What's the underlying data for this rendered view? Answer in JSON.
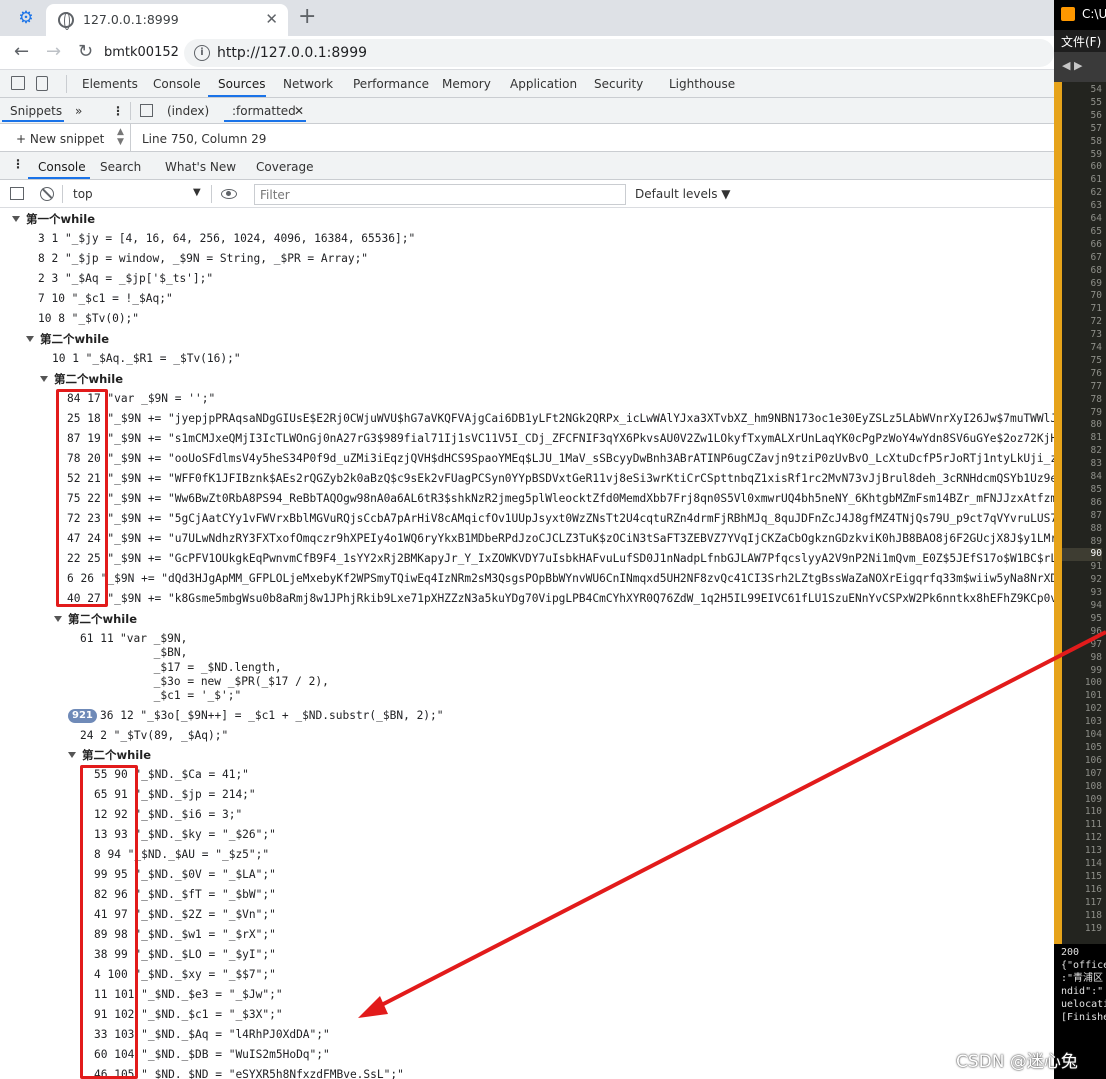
{
  "browser": {
    "tab_title": "127.0.0.1:8999",
    "profile_label": "bmtk00152",
    "url": "http://127.0.0.1:8999"
  },
  "devtools": {
    "tabs": [
      "Elements",
      "Console",
      "Sources",
      "Network",
      "Performance",
      "Memory",
      "Application",
      "Security",
      "Lighthouse"
    ],
    "active_tab": "Sources"
  },
  "sources": {
    "snippets_label": "Snippets",
    "more_label": "»",
    "file_index": "(index)",
    "file_formatted": ":formatted",
    "new_snippet": "+ New snippet",
    "position": "Line 750, Column 29"
  },
  "drawer": {
    "tabs": [
      "Console",
      "Search",
      "What's New",
      "Coverage"
    ],
    "active": "Console"
  },
  "console_toolbar": {
    "context": "top",
    "filter_placeholder": "Filter",
    "levels": "Default levels ▼"
  },
  "console": {
    "group1": "第一个while",
    "group2": "第二个while",
    "g1_rows": [
      "3 1 \"_$jy = [4, 16, 64, 256, 1024, 4096, 16384, 65536];\"",
      "8 2 \"_$jp = window, _$9N = String, _$PR = Array;\"",
      "2 3 \"_$Aq = _$jp['$_ts'];\"",
      "7 10 \"_$c1 = !_$Aq;\"",
      "10 8 \"_$Tv(0);\""
    ],
    "g2_row": "10 1 \"_$Aq._$R1 = _$Tv(16);\"",
    "box1_rows": [
      "84 17 \"var _$9N = '';\"",
      "25 18 \"_$9N += \"jyepjpPRAqsaNDgGIUsE$E2Rj0CWjuWVU$hG7aVKQFVAjgCai6DB1yLFt2NGk2QRPx_icLwWAlYJxa3XTvbXZ_hm9NBN173oc1e30EyZSLz5LAbWVnrXyI26Jw$7muTWWlJrk",
      "87 19 \"_$9N += \"s1mCMJxeQMjI3IcTLWOnGj0nA27rG3$989fial71Ij1sVC11V5I_CDj_ZFCFNIF3qYX6PkvsAU0V2Zw1LOkyfTxymALXrUnLaqYK0cPgPzWoY4wYdn8SV6uGYe$2oz72KjHN1N",
      "78 20 \"_$9N += \"ooUoSFdlmsV4y5heS34P0f9d_uZMi3iEqzjQVH$dHCS9SpaoYMEq$LJU_1MaV_sSBcyyDwBnh3ABrATINP6ugCZavjn9tziP0zUvBvO_LcXtuDcfP5rJoRTj1ntyLkUji_zQb",
      "52 21 \"_$9N += \"WFF0fK1JFIBznk$AEs2rQGZyb2k0aBzQ$c9sEk2vFUagPCSyn0YYpBSDVxtGeR11vj8eSi3wrKtiCrCSpttnbqZ1xisRf1rc2MvN73vJjBrul8deh_3cRNHdcmQSYb1Uz9e9eR",
      "75 22 \"_$9N += \"Ww6BwZt0RbA8PS94_ReBbTAQOgw98nA0a6AL6tR3$shkNzR2jmeg5plWleocktZfd0MemdXbb7Frj8qn0S5Vl0xmwrUQ4bh5neNY_6KhtgbMZmFsm14BZr_mFNJJzxAtfzmg6",
      "72 23 \"_$9N += \"5gCjAatCYy1vFWVrxBblMGVuRQjsCcbA7pArHiV8cAMqicfOv1UUpJsyxt0WzZNsTt2U4cqtuRZn4drmFjRBhMJq_8quJDFnZcJ4J8gfMZ4TNjQs79U_p9ct7qVYvruLUS7I1x",
      "47 24 \"_$9N += \"u7ULwNdhzRY3FXTxofOmqczr9hXPEIy4o1WQ6ryYkxB1MDbeRPdJzoCJCLZ3TuK$zOCiN3tSaFT3ZEBVZ7YVqIjCKZaCbOgkznGDzkviK0hJB8BAO8j6F2GUcjX8J$y1LMr6hi",
      "22 25 \"_$9N += \"GcPFV1OUkgkEqPwnvmCfB9F4_1sYY2xRj2BMKapyJr_Y_IxZOWKVDY7uIsbkHAFvuLufSD0J1nNadpLfnbGJLAW7PfqcslyyA2V9nP2Ni1mQvm_E0Z$5JEfS17o$W1BC$rL9A",
      "6 26 \"_$9N += \"dQd3HJgApMM_GFPLOLjeMxebyKf2WPSmyTQiwEq4IzNRm2sM3QsgsPOpBbWYnvWU6CnINmqxd5UH2NF8zvQc41CI3Srh2LZtgBssWaZaNOXrEigqrfq33m$wiiw5yNa8NrXDVZ4",
      "40 27 \"_$9N += \"k8Gsme5mbgWsu0b8aRmj8w1JPhjRkib9Lxe71pXHZZzN3a5kuYDg70VipgLPB4CmCYhXYR0Q76ZdW_1q2H5IL99EIVC61fLU1SzuENnYvCSPxW2Pk6nntkx8hEFhZ9KCp0vThW"
    ],
    "multi_head": "61 11",
    "multi_text": "\"var _$9N,\n     _$BN,\n     _$17 = _$ND.length,\n     _$3o = new _$PR(_$17 / 2),\n     _$c1 = '_$';\"",
    "badge_count": "921",
    "badge_row": "36 12 \"_$3o[_$9N++] = _$c1 + _$ND.substr(_$BN, 2);\"",
    "tv_row": "24 2 \"_$Tv(89, _$Aq);\"",
    "box2_rows": [
      "55 90 \"_$ND._$Ca = 41;\"",
      "65 91 \"_$ND._$jp = 214;\"",
      "12 92 \"_$ND._$i6 = 3;\"",
      "13 93 \"_$ND._$ky = \"_$26\";\"",
      "8 94 \"_$ND._$AU = \"_$z5\";\"",
      "99 95 \"_$ND._$0V = \"_$LA\";\"",
      "82 96 \"_$ND._$fT = \"_$bW\";\"",
      "41 97 \"_$ND._$2Z = \"_$Vn\";\"",
      "89 98 \"_$ND._$w1 = \"_$rX\";\"",
      "38 99 \"_$ND._$LO = \"_$yI\";\"",
      "4 100 \"_$ND._$xy = \"_$$7\";\"",
      "11 101 \"_$ND._$e3 = \"_$Jw\";\"",
      "91 102 \"_$ND._$c1 = \"_$3X\";\"",
      "33 103 \"_$ND._$Aq = \"l4RhPJ0XdDA\";\"",
      "60 104 \"_$ND._$DB = \"WuIS2m5HoDq\";\"",
      "46 105 \"_$ND._$ND = \"eSYXR5h8NfxzdFMBve.SsL\";\""
    ]
  },
  "editor": {
    "title": "C:\\U",
    "menu": "文件(F)",
    "line_numbers": [
      "54",
      "55",
      "56",
      "57",
      "58",
      "59",
      "60",
      "61",
      "62",
      "63",
      "64",
      "65",
      "66",
      "67",
      "68",
      "69",
      "70",
      "71",
      "72",
      "73",
      "74",
      "75",
      "76",
      "77",
      "78",
      "79",
      "80",
      "81",
      "82",
      "83",
      "84",
      "85",
      "86",
      "87",
      "88",
      "89",
      "90",
      "91",
      "92",
      "93",
      "94",
      "95",
      "96",
      "97",
      "98",
      "99",
      "100",
      "101",
      "102",
      "103",
      "104",
      "105",
      "106",
      "107",
      "108",
      "109",
      "110",
      "111",
      "112",
      "113",
      "114",
      "115",
      "116",
      "117",
      "118",
      "119"
    ],
    "current_line": "90",
    "output": [
      "200",
      "{\"office",
      ":\"青浦区",
      "ndid\":\"",
      "uelocati",
      "[Finishe"
    ]
  },
  "watermark": "CSDN @迷心兔",
  "colors": {
    "annotation_red": "#e21b1b",
    "accent_blue": "#1a73e8",
    "badge": "#6f8ab8"
  }
}
